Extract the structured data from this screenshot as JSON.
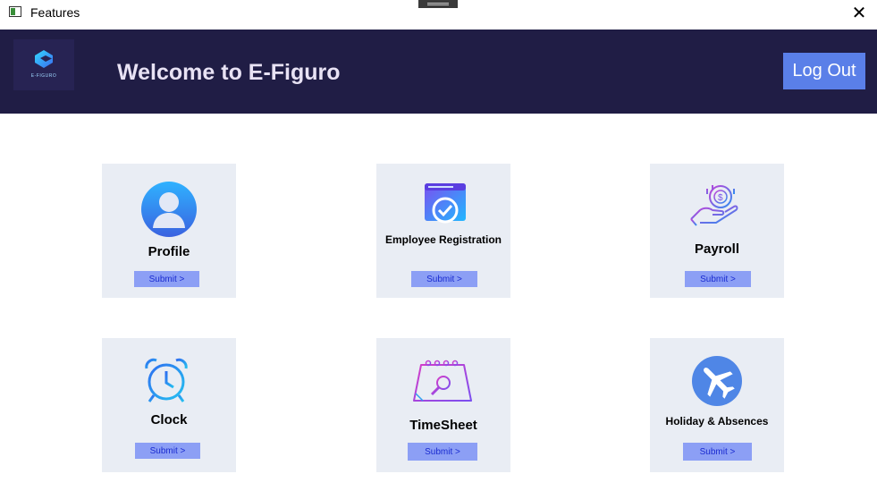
{
  "window": {
    "title": "Features",
    "close_glyph": "✕"
  },
  "header": {
    "logo_text": "E-FIGURO",
    "welcome": "Welcome to E-Figuro",
    "logout_label": "Log Out"
  },
  "cards": [
    {
      "label": "Profile",
      "submit": "Submit >",
      "icon": "user-avatar-icon"
    },
    {
      "label": "Employee Registration",
      "submit": "Submit >",
      "icon": "calendar-check-icon"
    },
    {
      "label": "Payroll",
      "submit": "Submit >",
      "icon": "hand-coin-icon"
    },
    {
      "label": "Clock",
      "submit": "Submit >",
      "icon": "alarm-clock-icon"
    },
    {
      "label": "TimeSheet",
      "submit": "Submit >",
      "icon": "calendar-search-icon"
    },
    {
      "label": "Holiday & Absences",
      "submit": "Submit >",
      "icon": "airplane-icon"
    }
  ],
  "colors": {
    "header_bg": "#201d45",
    "logout_bg": "#5a7fe8",
    "card_bg": "#e9edf4",
    "submit_bg": "#8c9ff5"
  }
}
